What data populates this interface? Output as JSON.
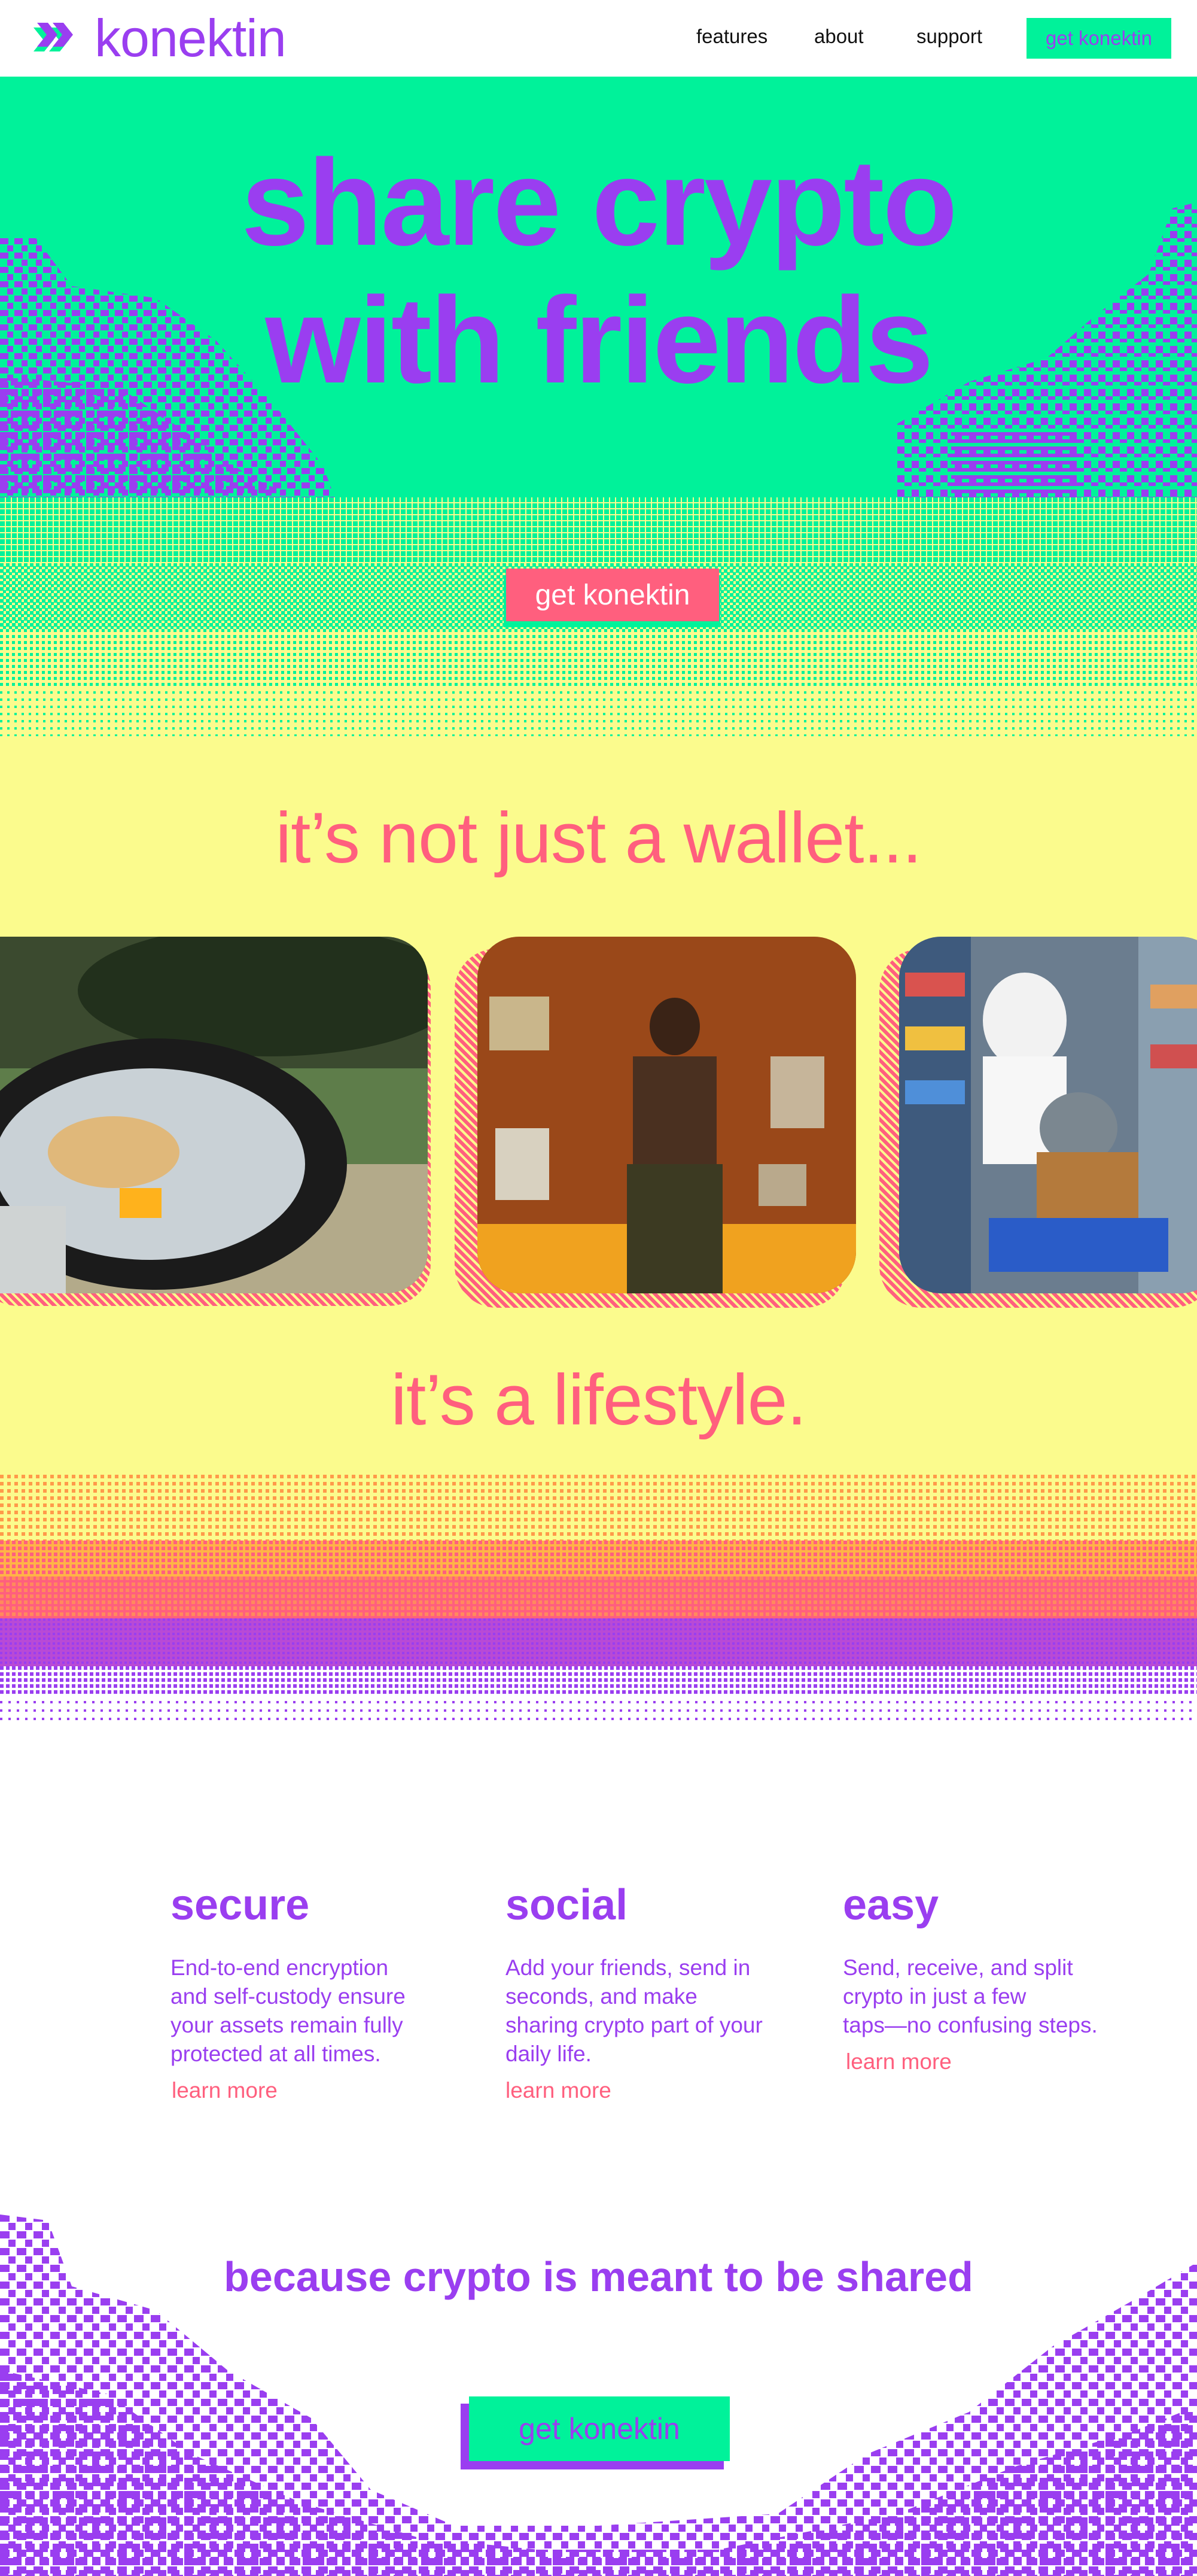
{
  "brand": {
    "name": "konektin",
    "icon": "konektin-logo-arrows-icon",
    "primary_color": "#9a3ef0",
    "accent_color": "#00f29a",
    "highlight_color": "#ff5f7e",
    "background_yellow": "#fbfb8d"
  },
  "nav": {
    "links": [
      "features",
      "about",
      "support"
    ],
    "cta_label": "get konektin"
  },
  "hero": {
    "title_line1": "share crypto",
    "title_line2": "with friends",
    "cta_label": "get konektin"
  },
  "wallet": {
    "title": "it’s not just a wallet...",
    "photos": [
      {
        "name": "photo-car-mirror",
        "description_icon": "photo-icon"
      },
      {
        "name": "photo-dancer-headphones",
        "description_icon": "photo-icon"
      },
      {
        "name": "photo-grocery-masks",
        "description_icon": "photo-icon"
      }
    ],
    "closing_title": "it’s a lifestyle."
  },
  "features": [
    {
      "heading": "secure",
      "text_lines": [
        "End-to-end encryption",
        "and self-custody ensure",
        "your assets remain fully",
        "protected at all times."
      ],
      "link": "learn more"
    },
    {
      "heading": "social",
      "text_lines": [
        "Add your friends, send in",
        "seconds, and make",
        "sharing crypto part of your",
        "daily life."
      ],
      "link": "learn more"
    },
    {
      "heading": "easy",
      "text_lines": [
        "Send, receive, and split",
        "crypto in just a few",
        "taps—no confusing steps."
      ],
      "link": "learn more"
    }
  ],
  "footer": {
    "title": "because crypto is meant to be shared",
    "cta_label": "get konektin"
  }
}
